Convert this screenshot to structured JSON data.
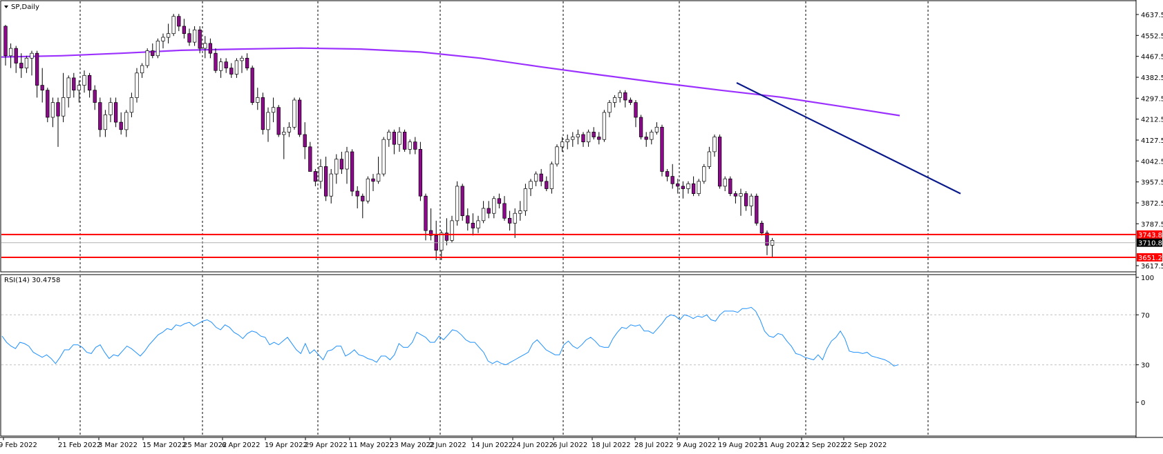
{
  "main_title": "SP,Daily",
  "rsi_title": "RSI(14) 30.4758",
  "colors": {
    "bull_candle": "#ffffff",
    "bear_candle": "#8a0a8a",
    "candle_outline": "#000000",
    "ma": "#9b30ff",
    "trendline": "#0a1a8a",
    "support_resistance": "#ff0000",
    "rsi_line": "#1e90ff",
    "grid": "#000000"
  },
  "chart_data": [
    {
      "type": "candlestick",
      "title": "SP,Daily",
      "ylim": [
        3600,
        4700
      ],
      "y_ticks": [
        "4637.5",
        "4552.5",
        "4467.5",
        "4382.5",
        "4297.5",
        "4212.5",
        "4127.5",
        "4042.5",
        "3957.5",
        "3872.5",
        "3787.5",
        "3617.5"
      ],
      "x_labels": [
        "9 Feb 2022",
        "21 Feb 2022",
        "3 Mar 2022",
        "15 Mar 2022",
        "25 Mar 2022",
        "6 Apr 2022",
        "19 Apr 2022",
        "29 Apr 2022",
        "11 May 2022",
        "23 May 2022",
        "2 Jun 2022",
        "14 Jun 2022",
        "24 Jun 2022",
        "6 Jul 2022",
        "18 Jul 2022",
        "28 Jul 2022",
        "9 Aug 2022",
        "19 Aug 2022",
        "31 Aug 2022",
        "12 Sep 2022",
        "22 Sep 2022"
      ],
      "price_tags": [
        {
          "value": 3743.8,
          "label": "3743.8",
          "color": "#ff0000"
        },
        {
          "value": 3710.8,
          "label": "3710.8",
          "color": "#000000"
        },
        {
          "value": 3651.2,
          "label": "3651.2",
          "color": "#ff0000"
        }
      ],
      "horizontal_levels": [
        3743.8,
        3651.2
      ],
      "moving_average_200": [
        4465,
        4470,
        4480,
        4492,
        4497,
        4501,
        4497,
        4485,
        4460,
        4425,
        4392,
        4360,
        4330,
        4302,
        4265,
        4227
      ],
      "trendline": {
        "from": {
          "date": "11 Aug 2022",
          "value": 4360
        },
        "to": {
          "date": "30 Sep 2022",
          "value": 3910
        }
      },
      "candles": [
        [
          4590,
          4595,
          4430,
          4470
        ],
        [
          4470,
          4520,
          4420,
          4500
        ],
        [
          4500,
          4510,
          4400,
          4440
        ],
        [
          4440,
          4480,
          4380,
          4420
        ],
        [
          4420,
          4470,
          4400,
          4460
        ],
        [
          4460,
          4490,
          4390,
          4480
        ],
        [
          4480,
          4490,
          4300,
          4350
        ],
        [
          4350,
          4420,
          4280,
          4330
        ],
        [
          4330,
          4340,
          4200,
          4220
        ],
        [
          4220,
          4300,
          4180,
          4280
        ],
        [
          4280,
          4300,
          4100,
          4225
        ],
        [
          4225,
          4400,
          4200,
          4300
        ],
        [
          4300,
          4390,
          4260,
          4380
        ],
        [
          4380,
          4400,
          4300,
          4330
        ],
        [
          4330,
          4370,
          4280,
          4350
        ],
        [
          4350,
          4410,
          4320,
          4390
        ],
        [
          4390,
          4400,
          4300,
          4330
        ],
        [
          4330,
          4350,
          4250,
          4280
        ],
        [
          4280,
          4300,
          4140,
          4170
        ],
        [
          4170,
          4250,
          4140,
          4230
        ],
        [
          4230,
          4300,
          4200,
          4280
        ],
        [
          4280,
          4300,
          4180,
          4200
        ],
        [
          4200,
          4240,
          4150,
          4170
        ],
        [
          4170,
          4250,
          4140,
          4240
        ],
        [
          4240,
          4320,
          4220,
          4300
        ],
        [
          4300,
          4420,
          4280,
          4400
        ],
        [
          4400,
          4440,
          4380,
          4430
        ],
        [
          4430,
          4500,
          4420,
          4490
        ],
        [
          4490,
          4520,
          4460,
          4470
        ],
        [
          4470,
          4540,
          4460,
          4530
        ],
        [
          4530,
          4560,
          4500,
          4545
        ],
        [
          4545,
          4600,
          4520,
          4560
        ],
        [
          4560,
          4640,
          4550,
          4630
        ],
        [
          4630,
          4640,
          4570,
          4590
        ],
        [
          4590,
          4620,
          4540,
          4560
        ],
        [
          4560,
          4580,
          4510,
          4525
        ],
        [
          4525,
          4590,
          4510,
          4575
        ],
        [
          4575,
          4590,
          4480,
          4500
        ],
        [
          4500,
          4550,
          4460,
          4520
        ],
        [
          4520,
          4540,
          4460,
          4480
        ],
        [
          4480,
          4500,
          4400,
          4410
        ],
        [
          4410,
          4460,
          4380,
          4445
        ],
        [
          4445,
          4460,
          4400,
          4420
        ],
        [
          4420,
          4440,
          4380,
          4395
        ],
        [
          4395,
          4460,
          4380,
          4450
        ],
        [
          4450,
          4470,
          4400,
          4460
        ],
        [
          4460,
          4480,
          4410,
          4420
        ],
        [
          4420,
          4430,
          4270,
          4280
        ],
        [
          4280,
          4340,
          4250,
          4300
        ],
        [
          4300,
          4320,
          4150,
          4170
        ],
        [
          4170,
          4260,
          4120,
          4240
        ],
        [
          4240,
          4300,
          4200,
          4260
        ],
        [
          4260,
          4270,
          4140,
          4150
        ],
        [
          4150,
          4180,
          4050,
          4160
        ],
        [
          4160,
          4200,
          4140,
          4180
        ],
        [
          4180,
          4300,
          4170,
          4290
        ],
        [
          4290,
          4300,
          4140,
          4150
        ],
        [
          4150,
          4200,
          4050,
          4100
        ],
        [
          4100,
          4120,
          4000,
          4000
        ],
        [
          4000,
          4010,
          3940,
          3960
        ],
        [
          3960,
          4050,
          3930,
          4020
        ],
        [
          4020,
          4060,
          3880,
          3900
        ],
        [
          3900,
          4010,
          3870,
          3990
        ],
        [
          3990,
          4070,
          3950,
          4050
        ],
        [
          4050,
          4080,
          3990,
          4010
        ],
        [
          4010,
          4100,
          3950,
          4080
        ],
        [
          4080,
          4090,
          3900,
          3920
        ],
        [
          3920,
          3940,
          3850,
          3900
        ],
        [
          3900,
          3910,
          3810,
          3880
        ],
        [
          3880,
          3980,
          3870,
          3970
        ],
        [
          3970,
          3990,
          3920,
          3960
        ],
        [
          3960,
          4060,
          3950,
          3990
        ],
        [
          3990,
          4140,
          3980,
          4130
        ],
        [
          4130,
          4170,
          4100,
          4160
        ],
        [
          4160,
          4170,
          4070,
          4110
        ],
        [
          4110,
          4180,
          4080,
          4160
        ],
        [
          4160,
          4170,
          4080,
          4090
        ],
        [
          4090,
          4130,
          4070,
          4120
        ],
        [
          4120,
          4140,
          4070,
          4090
        ],
        [
          4090,
          4120,
          3880,
          3900
        ],
        [
          3900,
          3910,
          3720,
          3760
        ],
        [
          3760,
          3850,
          3720,
          3740
        ],
        [
          3740,
          3800,
          3640,
          3680
        ],
        [
          3680,
          3760,
          3640,
          3750
        ],
        [
          3750,
          3810,
          3700,
          3720
        ],
        [
          3720,
          3820,
          3710,
          3800
        ],
        [
          3800,
          3960,
          3780,
          3940
        ],
        [
          3940,
          3950,
          3800,
          3820
        ],
        [
          3820,
          3850,
          3760,
          3790
        ],
        [
          3790,
          3830,
          3740,
          3770
        ],
        [
          3770,
          3820,
          3750,
          3800
        ],
        [
          3800,
          3880,
          3790,
          3850
        ],
        [
          3850,
          3880,
          3810,
          3830
        ],
        [
          3830,
          3900,
          3810,
          3890
        ],
        [
          3890,
          3910,
          3850,
          3870
        ],
        [
          3870,
          3900,
          3800,
          3810
        ],
        [
          3810,
          3840,
          3760,
          3790
        ],
        [
          3790,
          3850,
          3730,
          3830
        ],
        [
          3830,
          3880,
          3800,
          3840
        ],
        [
          3840,
          3950,
          3820,
          3930
        ],
        [
          3930,
          3970,
          3900,
          3960
        ],
        [
          3960,
          4000,
          3940,
          3990
        ],
        [
          3990,
          4010,
          3940,
          3960
        ],
        [
          3960,
          3980,
          3920,
          3930
        ],
        [
          3930,
          4040,
          3910,
          4030
        ],
        [
          4030,
          4110,
          4020,
          4100
        ],
        [
          4100,
          4140,
          4080,
          4120
        ],
        [
          4120,
          4150,
          4090,
          4130
        ],
        [
          4130,
          4160,
          4100,
          4140
        ],
        [
          4140,
          4170,
          4110,
          4150
        ],
        [
          4150,
          4160,
          4100,
          4120
        ],
        [
          4120,
          4170,
          4100,
          4160
        ],
        [
          4160,
          4180,
          4130,
          4140
        ],
        [
          4140,
          4160,
          4110,
          4130
        ],
        [
          4130,
          4250,
          4120,
          4240
        ],
        [
          4240,
          4290,
          4220,
          4280
        ],
        [
          4280,
          4310,
          4260,
          4300
        ],
        [
          4300,
          4330,
          4280,
          4320
        ],
        [
          4320,
          4330,
          4260,
          4290
        ],
        [
          4290,
          4300,
          4270,
          4280
        ],
        [
          4280,
          4290,
          4180,
          4220
        ],
        [
          4220,
          4230,
          4130,
          4140
        ],
        [
          4140,
          4160,
          4100,
          4130
        ],
        [
          4130,
          4170,
          4110,
          4160
        ],
        [
          4160,
          4200,
          4150,
          4180
        ],
        [
          4180,
          4190,
          3980,
          4000
        ],
        [
          4000,
          4010,
          3960,
          3980
        ],
        [
          3980,
          4030,
          3930,
          3950
        ],
        [
          3950,
          3970,
          3910,
          3940
        ],
        [
          3940,
          3960,
          3890,
          3930
        ],
        [
          3930,
          3960,
          3910,
          3950
        ],
        [
          3950,
          3980,
          3900,
          3910
        ],
        [
          3910,
          3970,
          3900,
          3960
        ],
        [
          3960,
          4030,
          3950,
          4020
        ],
        [
          4020,
          4100,
          4010,
          4080
        ],
        [
          4080,
          4150,
          4060,
          4140
        ],
        [
          4140,
          4150,
          3930,
          3940
        ],
        [
          3940,
          3980,
          3920,
          3970
        ],
        [
          3970,
          3980,
          3900,
          3910
        ],
        [
          3910,
          3920,
          3870,
          3900
        ],
        [
          3900,
          3930,
          3820,
          3910
        ],
        [
          3910,
          3920,
          3840,
          3860
        ],
        [
          3860,
          3910,
          3820,
          3900
        ],
        [
          3900,
          3910,
          3780,
          3790
        ],
        [
          3790,
          3800,
          3740,
          3750
        ],
        [
          3750,
          3760,
          3660,
          3700
        ],
        [
          3700,
          3730,
          3650,
          3720
        ]
      ]
    },
    {
      "type": "line",
      "title": "RSI(14) 30.4758",
      "ylim": [
        0,
        100
      ],
      "y_ticks": [
        "100",
        "70",
        "30",
        "0"
      ],
      "levels": [
        70,
        30
      ],
      "values": [
        53,
        48,
        45,
        43,
        48,
        47,
        45,
        40,
        38,
        36,
        38,
        35,
        31,
        36,
        42,
        42,
        46,
        46,
        44,
        40,
        39,
        44,
        46,
        40,
        35,
        38,
        37,
        41,
        45,
        43,
        40,
        37,
        41,
        46,
        50,
        54,
        56,
        59,
        58,
        62,
        61,
        63,
        64,
        61,
        63,
        65,
        66,
        64,
        60,
        58,
        62,
        60,
        56,
        54,
        51,
        55,
        57,
        56,
        53,
        52,
        46,
        48,
        46,
        49,
        52,
        47,
        42,
        39,
        47,
        39,
        42,
        38,
        34,
        41,
        42,
        45,
        45,
        37,
        39,
        42,
        38,
        37,
        35,
        34,
        32,
        37,
        37,
        34,
        38,
        47,
        44,
        44,
        48,
        56,
        54,
        52,
        48,
        48,
        53,
        50,
        54,
        58,
        57,
        54,
        50,
        48,
        48,
        44,
        40,
        33,
        31,
        33,
        31,
        30,
        32,
        34,
        36,
        38,
        40,
        47,
        50,
        46,
        42,
        40,
        38,
        38,
        46,
        49,
        45,
        43,
        46,
        50,
        52,
        49,
        45,
        44,
        44,
        51,
        56,
        60,
        59,
        62,
        61,
        62,
        57,
        57,
        55,
        59,
        63,
        68,
        70,
        69,
        66,
        70,
        69,
        67,
        69,
        68,
        70,
        66,
        65,
        70,
        73,
        73,
        73,
        72,
        75,
        75,
        76,
        73,
        66,
        57,
        53,
        52,
        55,
        54,
        49,
        45,
        39,
        38,
        36,
        35,
        34,
        38,
        34,
        43,
        49,
        52,
        57,
        51,
        41,
        40,
        40,
        39,
        40,
        37,
        36,
        35,
        34,
        32,
        29,
        30
      ]
    }
  ]
}
